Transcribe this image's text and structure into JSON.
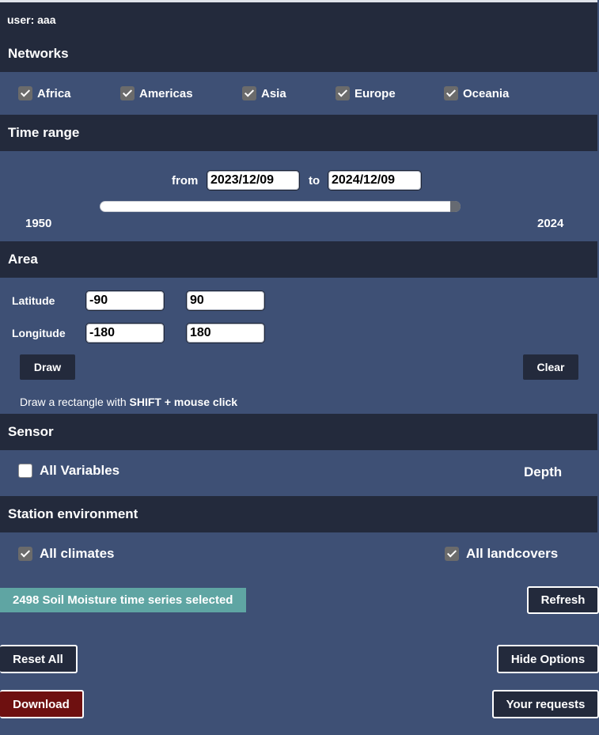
{
  "user": {
    "label": "user: aaa"
  },
  "networks": {
    "title": "Networks",
    "items": [
      {
        "label": "Africa",
        "checked": true
      },
      {
        "label": "Americas",
        "checked": true
      },
      {
        "label": "Asia",
        "checked": true
      },
      {
        "label": "Europe",
        "checked": true
      },
      {
        "label": "Oceania",
        "checked": true
      }
    ]
  },
  "time_range": {
    "title": "Time range",
    "from_label": "from",
    "from_value": "2023/12/09",
    "to_label": "to",
    "to_value": "2024/12/09",
    "min_label": "1950",
    "max_label": "2024",
    "slider_fraction": 0.985
  },
  "area": {
    "title": "Area",
    "latitude_label": "Latitude",
    "lat_min": "-90",
    "lat_max": "90",
    "longitude_label": "Longitude",
    "lon_min": "-180",
    "lon_max": "180",
    "draw_label": "Draw",
    "clear_label": "Clear",
    "hint_prefix": "Draw a rectangle with ",
    "hint_keys": "SHIFT + mouse click"
  },
  "sensor": {
    "title": "Sensor",
    "all_variables_label": "All Variables",
    "all_variables_checked": false,
    "depth_label": "Depth"
  },
  "station_environment": {
    "title": "Station environment",
    "all_climates_label": "All climates",
    "all_climates_checked": true,
    "all_landcovers_label": "All landcovers",
    "all_landcovers_checked": true
  },
  "status": {
    "selected_text": "2498 Soil Moisture time series selected"
  },
  "actions": {
    "refresh_label": "Refresh",
    "reset_all_label": "Reset All",
    "hide_options_label": "Hide Options",
    "download_label": "Download",
    "your_requests_label": "Your requests"
  },
  "colors": {
    "band": "#232a3c",
    "panel": "#3e5075",
    "status_badge": "#5fa5a3",
    "download": "#6e1010"
  }
}
